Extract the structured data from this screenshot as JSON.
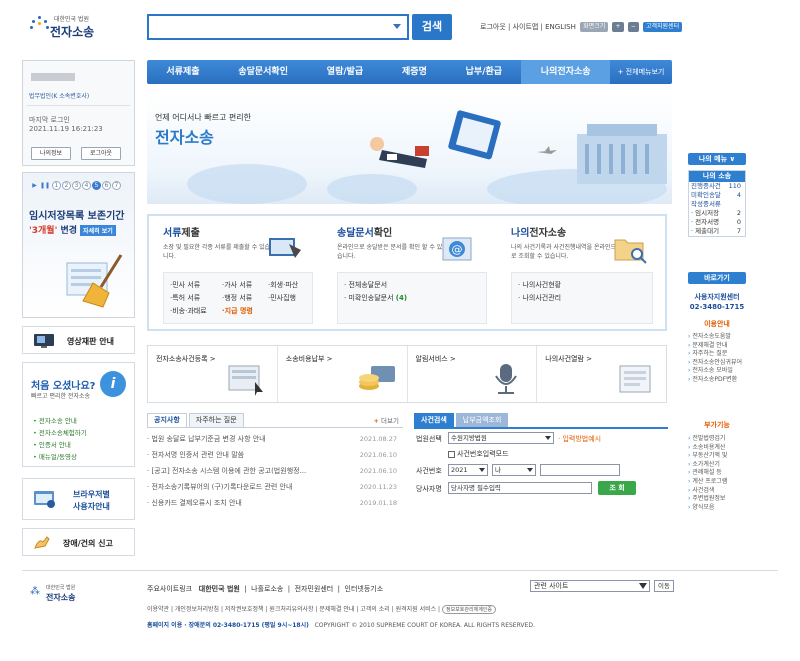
{
  "header": {
    "logo_small": "대한민국 법원",
    "logo_title": "전자소송",
    "search_placeholder": "",
    "search_button": "검색",
    "util_text": "로그아웃 | 사이트맵 | ENGLISH",
    "util_zoom": "화면크기",
    "util_plus": "+",
    "util_minus": "−",
    "util_center": "고객지원센터"
  },
  "gnb": {
    "items": [
      "서류제출",
      "송달문서확인",
      "열람/발급",
      "제증명",
      "납부/환급",
      "나의전자소송"
    ],
    "more": "+ 전체메뉴보기"
  },
  "login": {
    "org": "법무법인(K 소속변호사)",
    "last_login_label": "마지막 로그인",
    "last_login_time": "2021.11.19 16:21:23",
    "myinfo_button": "나의정보",
    "logout_button": "로그아웃"
  },
  "notice_banner": {
    "pager": [
      "1",
      "2",
      "3",
      "4",
      "5",
      "6",
      "7"
    ],
    "pager_active": "5",
    "title": "임시저장목록 보존기간",
    "period": "'3개월'",
    "period_suffix": "변경",
    "detail_tag": "자세히 보기"
  },
  "side_links": {
    "video": "영상재판 안내",
    "first_title": "처음 오셨나요?",
    "first_sub": "빠르고 편리한 전자소송",
    "first_items": [
      "전자소송 안내",
      "전자소송체험하기",
      "인증서 안내",
      "매뉴얼/동영상"
    ],
    "browser_line1": "브라우저별",
    "browser_line2": "사용자안내",
    "report": "장애/건의 신고"
  },
  "hero": {
    "subtitle": "언제 어디서나 빠르고 편리한",
    "title": "전자소송"
  },
  "services": {
    "s1": {
      "title_bold": "서류",
      "title_rest": "제출",
      "desc": "소장 및 필요한 각종 서류를 제출할 수 있습니다.",
      "col1": [
        "·민사 서류",
        "·특허 서류",
        "·비송·과태료"
      ],
      "col2": [
        "·가사 서류",
        "·행정 서류",
        "·지급 명령"
      ],
      "col3": [
        "·회생·파산",
        "·민사집행"
      ]
    },
    "s2": {
      "title_bold": "송달문서",
      "title_rest": "확인",
      "desc": "온라인으로 송달받은 문서를 확인 할 수 있습니다.",
      "items": [
        "· 전체송달문서",
        "· 미확인송달문서"
      ],
      "count": "(4)"
    },
    "s3": {
      "title_bold": "나의",
      "title_rest": "전자소송",
      "desc": "나의 사건기록과 사건진행내역을 온라인으로 조회할 수 있습니다.",
      "items": [
        "· 나의사건현황",
        "· 나의사건관리"
      ]
    }
  },
  "quick": [
    "전자소송사건등록 >",
    "소송비용납부 >",
    "알림서비스 >",
    "나의사건열람 >"
  ],
  "news": {
    "tab_notice": "공지사항",
    "tab_faq": "자주하는 질문",
    "more": "더보기",
    "rows": [
      {
        "title": "· 법원 송달료 납부기준금 변경 사항 안내",
        "date": "2021.08.27"
      },
      {
        "title": "· 전자서명 인증서 관련 안내 말씀",
        "date": "2021.06.10"
      },
      {
        "title": "· [공고] 전자소송 시스템 이용에 관한 공고(법원행정...",
        "date": "2021.06.10"
      },
      {
        "title": "· 전자소송기록뷰어의 (구)기록다운로드 관련 안내",
        "date": "2020.11.23"
      },
      {
        "title": "· 신용카드 결제오류시 조치 안내",
        "date": "2019.01.18"
      }
    ]
  },
  "case_search": {
    "tab_case": "사건검색",
    "tab_fee": "납부금액조회",
    "court_label": "법원선택",
    "court_value": "수원지방법원",
    "input_hint": "· 입력방법예시",
    "case_num_checkbox": "사건번호입력모드",
    "case_num_label": "사건번호",
    "year": "2021",
    "type": "나",
    "party_label": "당사자명",
    "party_value": "당사자명 필수입력",
    "submit": "조 회"
  },
  "right_col": {
    "my_menu": "나의 메뉴 ∨",
    "my_suit": "나의 소송",
    "rows": [
      {
        "label": "진행중사건",
        "count": "110"
      },
      {
        "label": "미확인송달",
        "count": "4"
      },
      {
        "label": "작성중서류",
        "count": ""
      },
      {
        "label": "· 임시저장",
        "count": "2"
      },
      {
        "label": "· 전자서명",
        "count": "0"
      },
      {
        "label": "· 제출대기",
        "count": "7"
      }
    ],
    "shortcut": "바로가기",
    "center_line1": "사용자지원센터",
    "center_phone": "02-3480-1715",
    "guide_title": "이용안내",
    "guide_items": [
      "전자소송도움말",
      "문제해결 안내",
      "자주하는 질문",
      "전자소송안심귀뷰어",
      "전자소송 모바일",
      "전자소송PDF변환"
    ],
    "extra_title": "부가기능",
    "extra_items": [
      "전발법령검기",
      "소송비용계산",
      "부동산기액 및",
      "소가계산기",
      "관례해설 등",
      "계산 프로그램",
      "사건검색",
      "주변법원정보",
      "양식모음"
    ]
  },
  "footer": {
    "logo_small": "대한민국 법원",
    "logo_title": "전자소송",
    "links_prefix": "주요사이트링크",
    "links": [
      "대한민국 법원",
      "나홀로소송",
      "전자민원센터",
      "인터넷등기소"
    ],
    "site_select": "관련 사이트",
    "go_button": "이동",
    "policy": "이용약관 | 개인정보처리방침 | 저작권보호정책 | 원크처리유의사항 | 문제해결 안내 | 고객의 소리 | 원격지원 서비스 |",
    "privacy_badge": "정보보호관리체계인증",
    "contact": "홈페이지 이용 · 장애문의 02-3480-1715 (평일 9시~18시)",
    "copyright": "COPYRIGHT © 2010 SUPREME COURT OF KOREA. ALL RIGHTS RESERVED."
  }
}
